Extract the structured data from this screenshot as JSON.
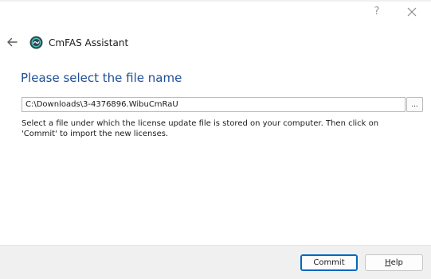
{
  "window": {
    "title": "CmFAS Assistant",
    "help_glyph": "?",
    "icons": {
      "help": "question-mark-icon",
      "close": "close-icon",
      "back": "back-arrow-icon",
      "logo": "cmfas-logo-icon"
    }
  },
  "page": {
    "heading": "Please select the file name",
    "file_path": "C:\\Downloads\\3-4376896.WibuCmRaU",
    "browse_label": "...",
    "instructions": "Select a file under which the license update file is stored on your computer. Then click on 'Commit' to import the new licenses."
  },
  "buttons": {
    "commit_label": "Commit",
    "help_mnemonic": "H",
    "help_rest": "elp"
  },
  "colors": {
    "heading": "#1f4e96",
    "accent": "#0067c0",
    "button_bar": "#f0f0f0"
  }
}
